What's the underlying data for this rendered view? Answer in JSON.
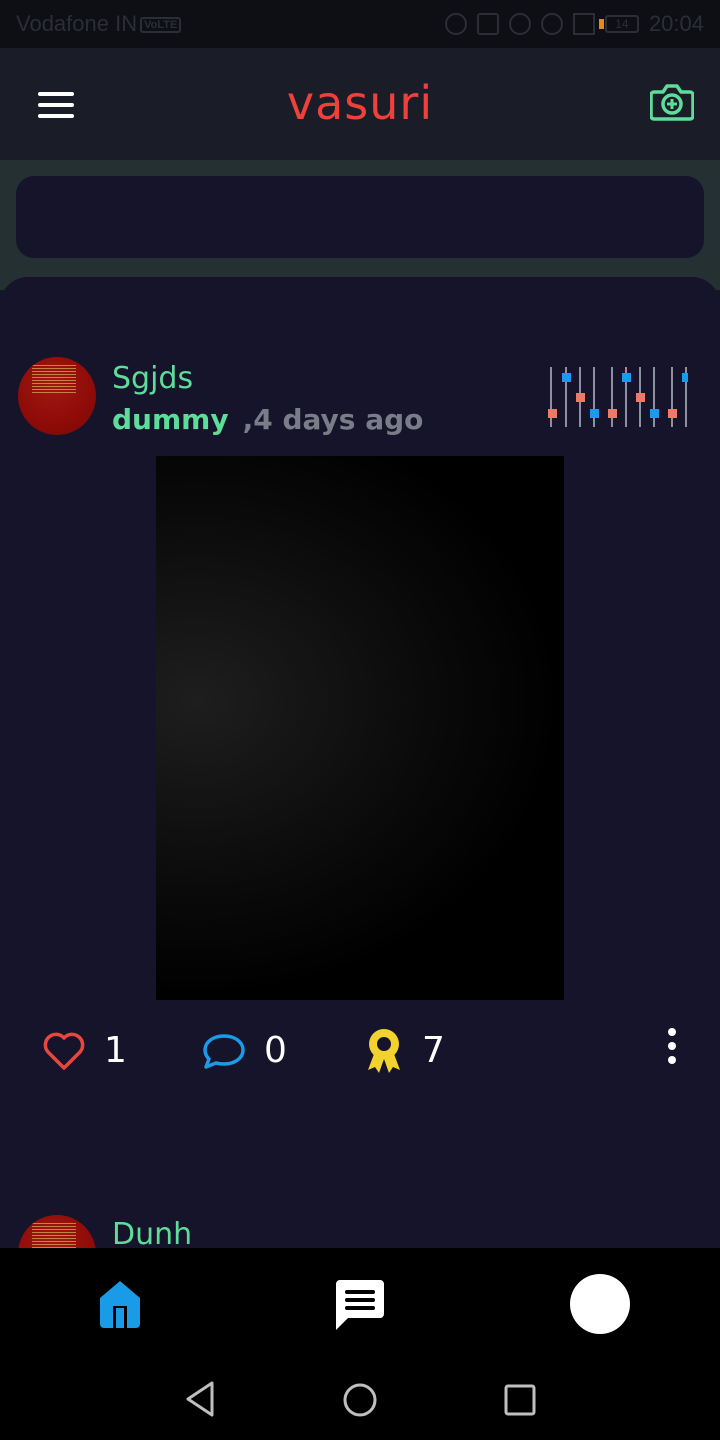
{
  "status_bar": {
    "carrier": "Vodafone IN",
    "volte": "VoLTE",
    "battery": "14",
    "time": "20:04"
  },
  "header": {
    "title": "vasuri",
    "menu_icon": "hamburger-menu-icon",
    "camera_icon": "add-camera-icon"
  },
  "feed": {
    "posts": [
      {
        "username": "Sgjds",
        "handle": "dummy",
        "time": ",4 days ago",
        "likes": "1",
        "comments": "0",
        "awards": "7"
      },
      {
        "username": "Dunh"
      }
    ]
  },
  "bottom_nav": {
    "items": [
      "home-icon",
      "chat-icon",
      "profile-avatar"
    ],
    "active": "home-icon"
  },
  "colors": {
    "brand": "#f0403b",
    "accent_green": "#5ddc9a",
    "like_red": "#e8473e",
    "comment_blue": "#1a9be8",
    "award_yellow": "#f2d22e",
    "background": "#15142a"
  }
}
